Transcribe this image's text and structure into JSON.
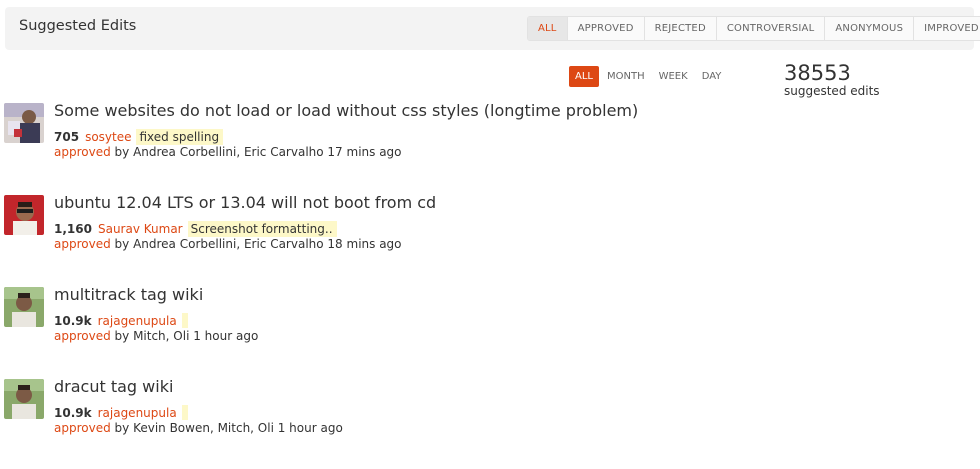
{
  "header": {
    "title": "Suggested Edits",
    "filter_tabs": [
      {
        "label": "ALL",
        "active": true
      },
      {
        "label": "APPROVED",
        "active": false
      },
      {
        "label": "REJECTED",
        "active": false
      },
      {
        "label": "CONTROVERSIAL",
        "active": false
      },
      {
        "label": "ANONYMOUS",
        "active": false
      },
      {
        "label": "IMPROVED",
        "active": false
      }
    ]
  },
  "period_tabs": [
    {
      "label": "ALL",
      "active": true
    },
    {
      "label": "MONTH",
      "active": false
    },
    {
      "label": "WEEK",
      "active": false
    },
    {
      "label": "DAY",
      "active": false
    }
  ],
  "stats": {
    "count": "38553",
    "label": "suggested edits"
  },
  "edits": [
    {
      "title": "Some websites do not load or load without css styles (longtime problem)",
      "reputation": "705",
      "user": "sosytee",
      "comment": "fixed spelling",
      "status": "approved",
      "reviewed_by": "by Andrea Corbellini, Eric Carvalho 17 mins ago"
    },
    {
      "title": "ubuntu 12.04 LTS or 13.04 will not boot from cd",
      "reputation": "1,160",
      "user": "Saurav Kumar",
      "comment": "Screenshot formatting..",
      "status": "approved",
      "reviewed_by": "by Andrea Corbellini, Eric Carvalho 18 mins ago"
    },
    {
      "title": "multitrack tag wiki",
      "reputation": "10.9k",
      "user": "rajagenupula",
      "comment": "",
      "status": "approved",
      "reviewed_by": "by Mitch, Oli 1 hour ago"
    },
    {
      "title": "dracut tag wiki",
      "reputation": "10.9k",
      "user": "rajagenupula",
      "comment": "",
      "status": "approved",
      "reviewed_by": "by Kevin Bowen, Mitch, Oli 1 hour ago"
    }
  ],
  "colors": {
    "accent": "#dd4814",
    "comment_highlight": "#fdf8c8",
    "header_bg": "#f3f3f3"
  }
}
